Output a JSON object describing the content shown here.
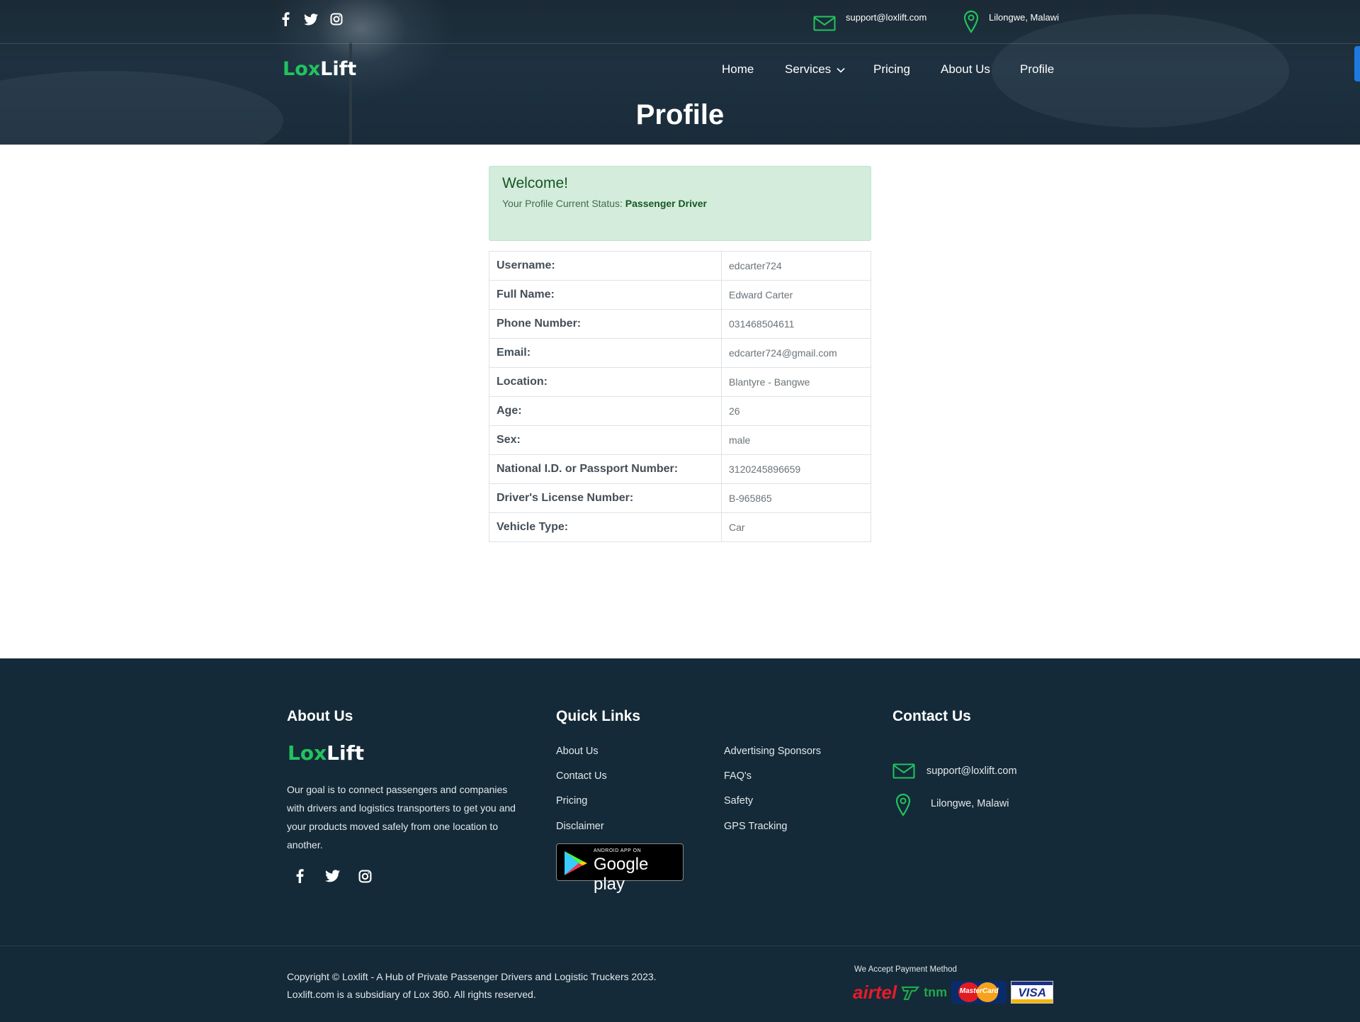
{
  "topbar": {
    "email": "support@loxlift.com",
    "location": "Lilongwe, Malawi",
    "social": [
      "facebook-icon",
      "twitter-icon",
      "instagram-icon"
    ]
  },
  "brand": {
    "lox": "Lox",
    "lift": "Lift",
    "color_lox": "#22c35e",
    "color_lift": "#ffffff"
  },
  "nav": {
    "items": [
      {
        "label": "Home"
      },
      {
        "label": "Services",
        "has_dropdown": true
      },
      {
        "label": "Pricing"
      },
      {
        "label": "About Us"
      },
      {
        "label": "Profile"
      }
    ]
  },
  "page": {
    "title": "Profile"
  },
  "welcome": {
    "heading": "Welcome!",
    "status_label": "Your Profile Current Status:",
    "status_value": "Passenger Driver"
  },
  "profile": {
    "rows": [
      {
        "label": "Username:",
        "value": "edcarter724"
      },
      {
        "label": "Full Name:",
        "value": "Edward Carter"
      },
      {
        "label": "Phone Number:",
        "value": "031468504611"
      },
      {
        "label": "Email:",
        "value": "edcarter724@gmail.com"
      },
      {
        "label": "Location:",
        "value": "Blantyre - Bangwe"
      },
      {
        "label": "Age:",
        "value": "26"
      },
      {
        "label": "Sex:",
        "value": "male"
      },
      {
        "label": "National I.D. or Passport Number:",
        "value": "3120245896659"
      },
      {
        "label": "Driver's License Number:",
        "value": "B-965865"
      },
      {
        "label": "Vehicle Type:",
        "value": "Car"
      }
    ]
  },
  "footer": {
    "about_heading": "About Us",
    "about_text": "Our goal is to connect passengers and companies with drivers and logistics transporters to get you and your products moved safely from one location to another.",
    "quick_links_heading": "Quick Links",
    "links_col1": [
      "About Us",
      "Contact Us",
      "Pricing",
      "Disclaimer"
    ],
    "links_col2": [
      "Advertising Sponsors",
      "FAQ's",
      "Safety",
      "GPS Tracking"
    ],
    "google_play_small": "ANDROID APP ON",
    "google_play_big": "Google play",
    "contact_heading": "Contact Us",
    "contact_email": "support@loxlift.com",
    "contact_location": "Lilongwe, Malawi",
    "copyright_line1": "Copyright © Loxlift - A Hub of Private Passenger Drivers and Logistic Truckers 2023.",
    "copyright_line2": "Loxlift.com is a subsidiary of Lox 360. All rights reserved.",
    "payment_label": "We Accept Payment Method",
    "payment_methods": [
      "airtel",
      "tnm",
      "MasterCard",
      "VISA"
    ]
  },
  "colors": {
    "accent_green": "#22c35e",
    "footer_bg": "#142a38",
    "alert_bg": "#d4ecdb"
  }
}
